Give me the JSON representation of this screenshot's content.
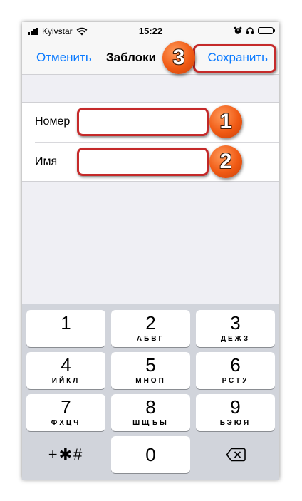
{
  "status_bar": {
    "carrier": "Kyivstar",
    "time": "15:22"
  },
  "nav": {
    "cancel": "Отменить",
    "title": "Заблоки",
    "save": "Сохранить"
  },
  "form": {
    "number_label": "Номер",
    "number_value": "",
    "name_label": "Имя",
    "name_value": ""
  },
  "annotations": [
    "1",
    "2",
    "3"
  ],
  "colors": {
    "accent": "#0a7aff",
    "highlight_border": "#c52a2a",
    "badge": "#f05a14",
    "keyboard_bg": "#d1d4db"
  },
  "keypad": {
    "keys": [
      {
        "digit": "1",
        "letters": ""
      },
      {
        "digit": "2",
        "letters": "АБВГ"
      },
      {
        "digit": "3",
        "letters": "ДЕЖЗ"
      },
      {
        "digit": "4",
        "letters": "ИЙКЛ"
      },
      {
        "digit": "5",
        "letters": "МНОП"
      },
      {
        "digit": "6",
        "letters": "РСТУ"
      },
      {
        "digit": "7",
        "letters": "ФХЦЧ"
      },
      {
        "digit": "8",
        "letters": "ШЩЪЫ"
      },
      {
        "digit": "9",
        "letters": "ЬЭЮЯ"
      }
    ],
    "symbols": "+✱#",
    "zero": "0",
    "delete_icon": "backspace-icon"
  }
}
